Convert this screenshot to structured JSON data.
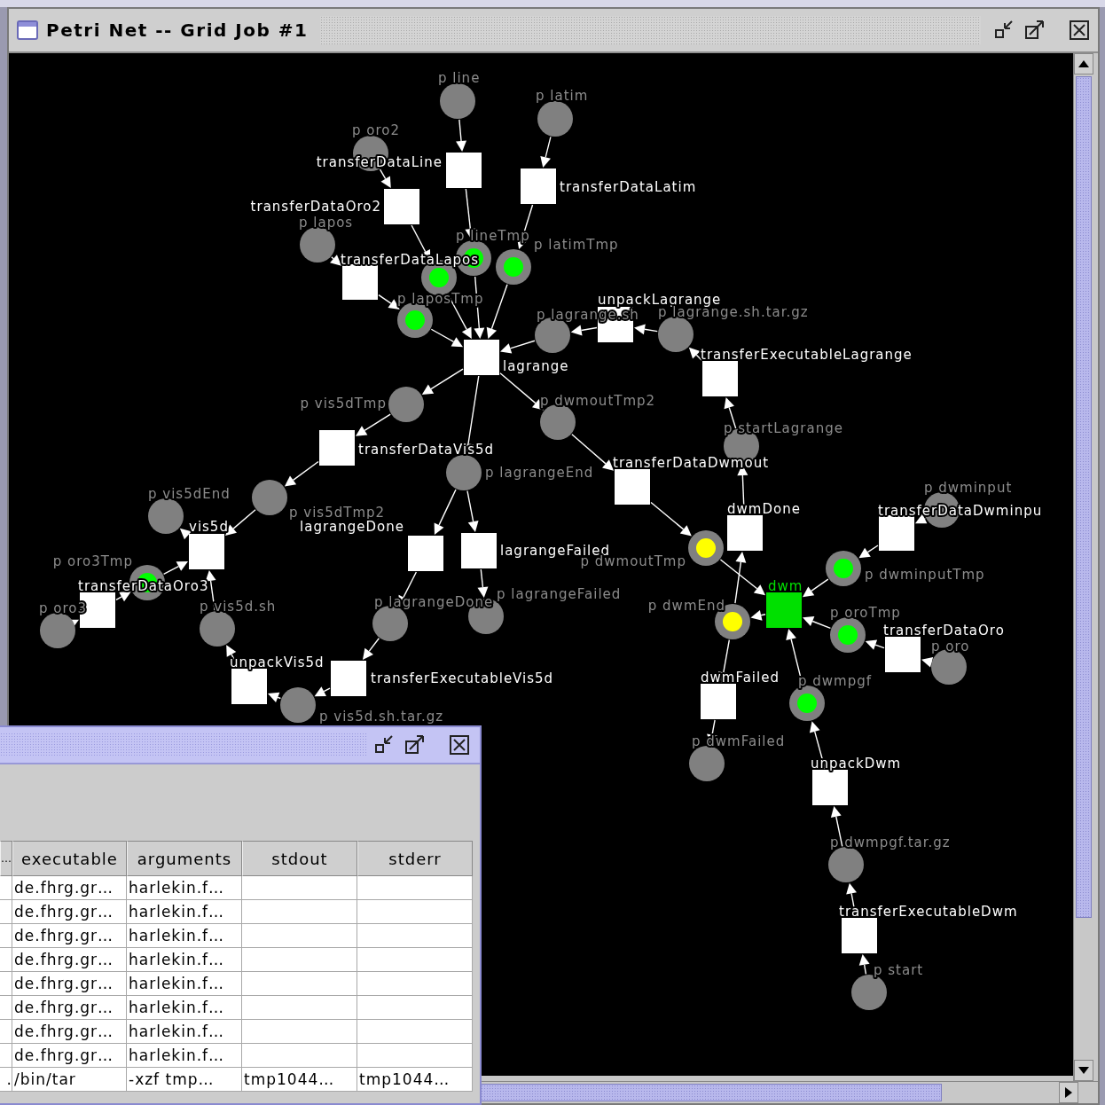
{
  "window": {
    "title": "Petri Net -- Grid Job #1"
  },
  "net": {
    "nodes": [
      {
        "kind": "place",
        "label": "p line"
      },
      {
        "kind": "place",
        "label": "p latim"
      },
      {
        "kind": "place",
        "label": "p oro2"
      },
      {
        "kind": "transition",
        "label": "transferDataLine",
        "active": false
      },
      {
        "kind": "transition",
        "label": "transferDataLatim",
        "active": false
      },
      {
        "kind": "transition",
        "label": "transferDataOro2",
        "active": false
      },
      {
        "kind": "place",
        "label": "p lapos"
      },
      {
        "kind": "place",
        "label": "p lineTmp",
        "color": "#00ff00"
      },
      {
        "kind": "place",
        "label": "p latimTmp",
        "color": "#00ff00"
      },
      {
        "kind": "transition",
        "label": "transferDataLapos",
        "active": false
      },
      {
        "kind": "place",
        "color": "#00ff00"
      },
      {
        "kind": "place",
        "label": "p laposTmp",
        "color": "#00ff00"
      },
      {
        "kind": "transition",
        "label": "lagrange",
        "active": false
      },
      {
        "kind": "place",
        "label": "p lagrange.sh"
      },
      {
        "kind": "transition",
        "label": "unpackLagrange",
        "active": false
      },
      {
        "kind": "place",
        "label": "p lagrange.sh.tar.gz"
      },
      {
        "kind": "transition",
        "label": "transferExecutableLagrange",
        "active": false
      },
      {
        "kind": "place",
        "label": "p vis5dTmp"
      },
      {
        "kind": "place",
        "label": "p dwmoutTmp2"
      },
      {
        "kind": "transition",
        "label": "transferDataVis5d",
        "active": false
      },
      {
        "kind": "place",
        "label": "p startLagrange"
      },
      {
        "kind": "place",
        "label": "p lagrangeEnd"
      },
      {
        "kind": "transition",
        "label": "transferDataDwmout",
        "active": false
      },
      {
        "kind": "place",
        "label": "p vis5dTmp2"
      },
      {
        "kind": "place",
        "label": "p vis5dEnd"
      },
      {
        "kind": "transition",
        "label": "vis5d",
        "active": false
      },
      {
        "kind": "place",
        "label": "p oro3Tmp",
        "color": "#00ff00"
      },
      {
        "kind": "transition",
        "label": "transferDataOro3",
        "active": false
      },
      {
        "kind": "place",
        "label": "p oro3"
      },
      {
        "kind": "place",
        "label": "p vis5d.sh"
      },
      {
        "kind": "transition",
        "label": "lagrangeDone",
        "active": false
      },
      {
        "kind": "transition",
        "label": "lagrangeFailed",
        "active": false
      },
      {
        "kind": "place",
        "label": "p lagrangeDone"
      },
      {
        "kind": "place",
        "label": "p lagrangeFailed"
      },
      {
        "kind": "transition",
        "label": "unpackVis5d",
        "active": false
      },
      {
        "kind": "transition",
        "label": "transferExecutableVis5d",
        "active": false
      },
      {
        "kind": "place",
        "label": "p vis5d.sh.tar.gz"
      },
      {
        "kind": "place",
        "label": "p dwmoutTmp",
        "color": "#ffff00"
      },
      {
        "kind": "transition",
        "label": "dwmDone",
        "active": false
      },
      {
        "kind": "place",
        "label": "p dwminput"
      },
      {
        "kind": "transition",
        "label": "transferDataDwminpu",
        "active": false
      },
      {
        "kind": "place",
        "label": "p dwminputTmp",
        "color": "#00ff00"
      },
      {
        "kind": "transition",
        "label": "dwm",
        "active": true
      },
      {
        "kind": "place",
        "label": "p dwmEnd",
        "color": "#ffff00"
      },
      {
        "kind": "place",
        "label": "p oroTmp",
        "color": "#00ff00"
      },
      {
        "kind": "transition",
        "label": "transferDataOro",
        "active": false
      },
      {
        "kind": "place",
        "label": "p oro"
      },
      {
        "kind": "transition",
        "label": "dwmFailed",
        "active": false
      },
      {
        "kind": "place",
        "label": "p dwmpgf",
        "color": "#00ff00"
      },
      {
        "kind": "place",
        "label": "p dwmFailed"
      },
      {
        "kind": "transition",
        "label": "unpackDwm",
        "active": false
      },
      {
        "kind": "place",
        "label": "p dwmpgf.tar.gz"
      },
      {
        "kind": "transition",
        "label": "transferExecutableDwm",
        "active": false
      },
      {
        "kind": "place",
        "label": "p start"
      }
    ]
  },
  "job_window": {
    "table": {
      "columns": [
        "…",
        "executable",
        "arguments",
        "stdout",
        "stderr"
      ],
      "rows": [
        {
          "executable": "de.fhrg.gr…",
          "arguments": "harlekin.f…"
        },
        {
          "executable": "de.fhrg.gr…",
          "arguments": "harlekin.f…"
        },
        {
          "executable": "de.fhrg.gr…",
          "arguments": "harlekin.f…"
        },
        {
          "executable": "de.fhrg.gr…",
          "arguments": "harlekin.f…"
        },
        {
          "executable": "de.fhrg.gr…",
          "arguments": "harlekin.f…"
        },
        {
          "executable": "de.fhrg.gr…",
          "arguments": "harlekin.f…"
        },
        {
          "executable": "de.fhrg.gr…",
          "arguments": "harlekin.f…"
        },
        {
          "executable": "de.fhrg.gr…",
          "arguments": "harlekin.f…"
        },
        {
          "column_1": ".",
          "executable": "/bin/tar",
          "arguments": "-xzf tmp…",
          "stdout": "tmp1044…",
          "stderr": "tmp1044…"
        }
      ]
    }
  }
}
